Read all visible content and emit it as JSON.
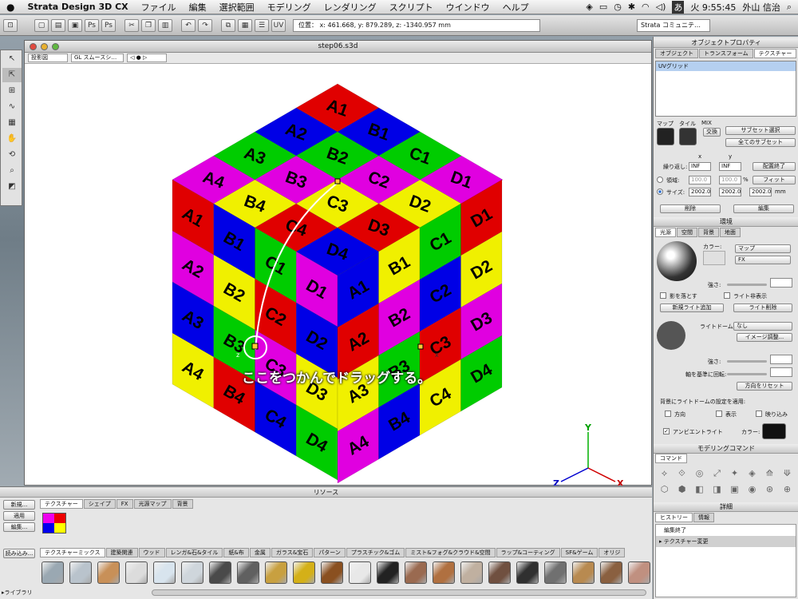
{
  "menubar": {
    "apple": "",
    "app": "Strata Design 3D CX",
    "items": [
      "ファイル",
      "編集",
      "選択範囲",
      "モデリング",
      "レンダリング",
      "スクリプト",
      "ウインドウ",
      "ヘルプ"
    ],
    "ime": "あ",
    "clock": "火 9:55:45",
    "user": "外山 信治"
  },
  "toolbar": {
    "position": "位置： x: 461.668, y: 879.289, z: -1340.957 mm",
    "community": "Strata コミュニテ…",
    "icon_labels": [
      "Ps",
      "Ps",
      "UV"
    ]
  },
  "document": {
    "title": "step06.s3d",
    "view_mode": "投影図",
    "render_mode": "GL スムースシ…"
  },
  "callout": "ここをつかんでドラッグする。",
  "axes": {
    "y": "Y",
    "z": "Z",
    "x": "X",
    "hz": "z",
    "hx": "x"
  },
  "cube": {
    "top": [
      [
        "A1",
        "B1",
        "C1",
        "D1"
      ],
      [
        "A2",
        "B2",
        "C2",
        "D2"
      ],
      [
        "A3",
        "B3",
        "C3",
        "D3"
      ],
      [
        "A4",
        "B4",
        "C4",
        "D4"
      ]
    ],
    "left": [
      "A1",
      "B1",
      "C1",
      "D1",
      "A2",
      "B2",
      "C2",
      "D2",
      "A3",
      "B3",
      "C3",
      "D3",
      "A4",
      "B4",
      "C4",
      "D4"
    ],
    "right": [
      "A1",
      "B1",
      "C1",
      "D1",
      "A2",
      "B2",
      "C2",
      "D2",
      "A3",
      "B3",
      "C3",
      "D3",
      "A4",
      "B4",
      "C4",
      "D4"
    ]
  },
  "resources": {
    "title": "リソース",
    "buttons": [
      "新規...",
      "適用",
      "編集...",
      "読み込み..."
    ],
    "tabs": [
      "テクスチャー",
      "シェイプ",
      "FX",
      "光源マップ",
      "背景"
    ],
    "categories": [
      "テクスチャーミックス",
      "建築関連",
      "ウッド",
      "レンガ&石&タイル",
      "紙&布",
      "金属",
      "ガラス&宝石",
      "パターン",
      "プラスチック&ゴム",
      "ミスト&フォグ&クラウド&空間",
      "ラップ&コーティング",
      "SF&ゲーム",
      "オリジ"
    ],
    "library": "▸ライブラリ"
  },
  "object_props": {
    "title": "オブジェクトプロパティ",
    "tabs": [
      "オブジェクト",
      "トランスフォーム",
      "テクスチャー"
    ],
    "texture": "UVグリッド",
    "map_labels": [
      "マップ",
      "タイル",
      "MIX"
    ],
    "swap": "交換",
    "subset_select": "サブセット選択",
    "all_subsets": "全てのサブセット",
    "x": "x",
    "y": "y",
    "repeat": "繰り返し:",
    "inf_x": "INF",
    "inf_y": "INF",
    "done": "配置終了",
    "area": "領域:",
    "area_x": "100.0",
    "area_y": "100.0",
    "pct": "%",
    "fit": "フィット",
    "size": "サイズ:",
    "size_x": "2002.0",
    "size_y": "2002.0",
    "size_z": "2002.0",
    "mm": "mm",
    "delete": "削除",
    "edit": "編集"
  },
  "environment": {
    "title": "環境",
    "tabs": [
      "光源",
      "空間",
      "背景",
      "地面"
    ],
    "color": "カラー:",
    "map": "マップ",
    "fx": "FX",
    "strength": "強さ:",
    "cast_shadow": "影を落とす",
    "light_hide": "ライト非表示",
    "add_light": "新規ライト追加",
    "del_light": "ライト削除",
    "light_dome": "ライトドーム:",
    "none": "なし",
    "image_adj": "イメージ調整...",
    "strength2": "強さ:",
    "rotate_axis": "軸を基準に回転:",
    "reset_dir": "方向をリセット",
    "apply_bg": "背景にライトドームの設定を適用:",
    "dir": "方向",
    "show": "表示",
    "blur": "映り込み",
    "ambient": "アンビエントライト",
    "color2": "カラー:"
  },
  "modeling": {
    "title": "モデリングコマンド",
    "tab": "コマンド"
  },
  "details": {
    "title": "詳細",
    "tabs": [
      "ヒストリー",
      "情報"
    ],
    "items": [
      "編集終了",
      "テクスチャー変更"
    ]
  },
  "colors": {
    "red": "#e00000",
    "magenta": "#e000e0",
    "blue": "#0000e6",
    "yellow": "#f0f000",
    "green": "#00cc00"
  }
}
